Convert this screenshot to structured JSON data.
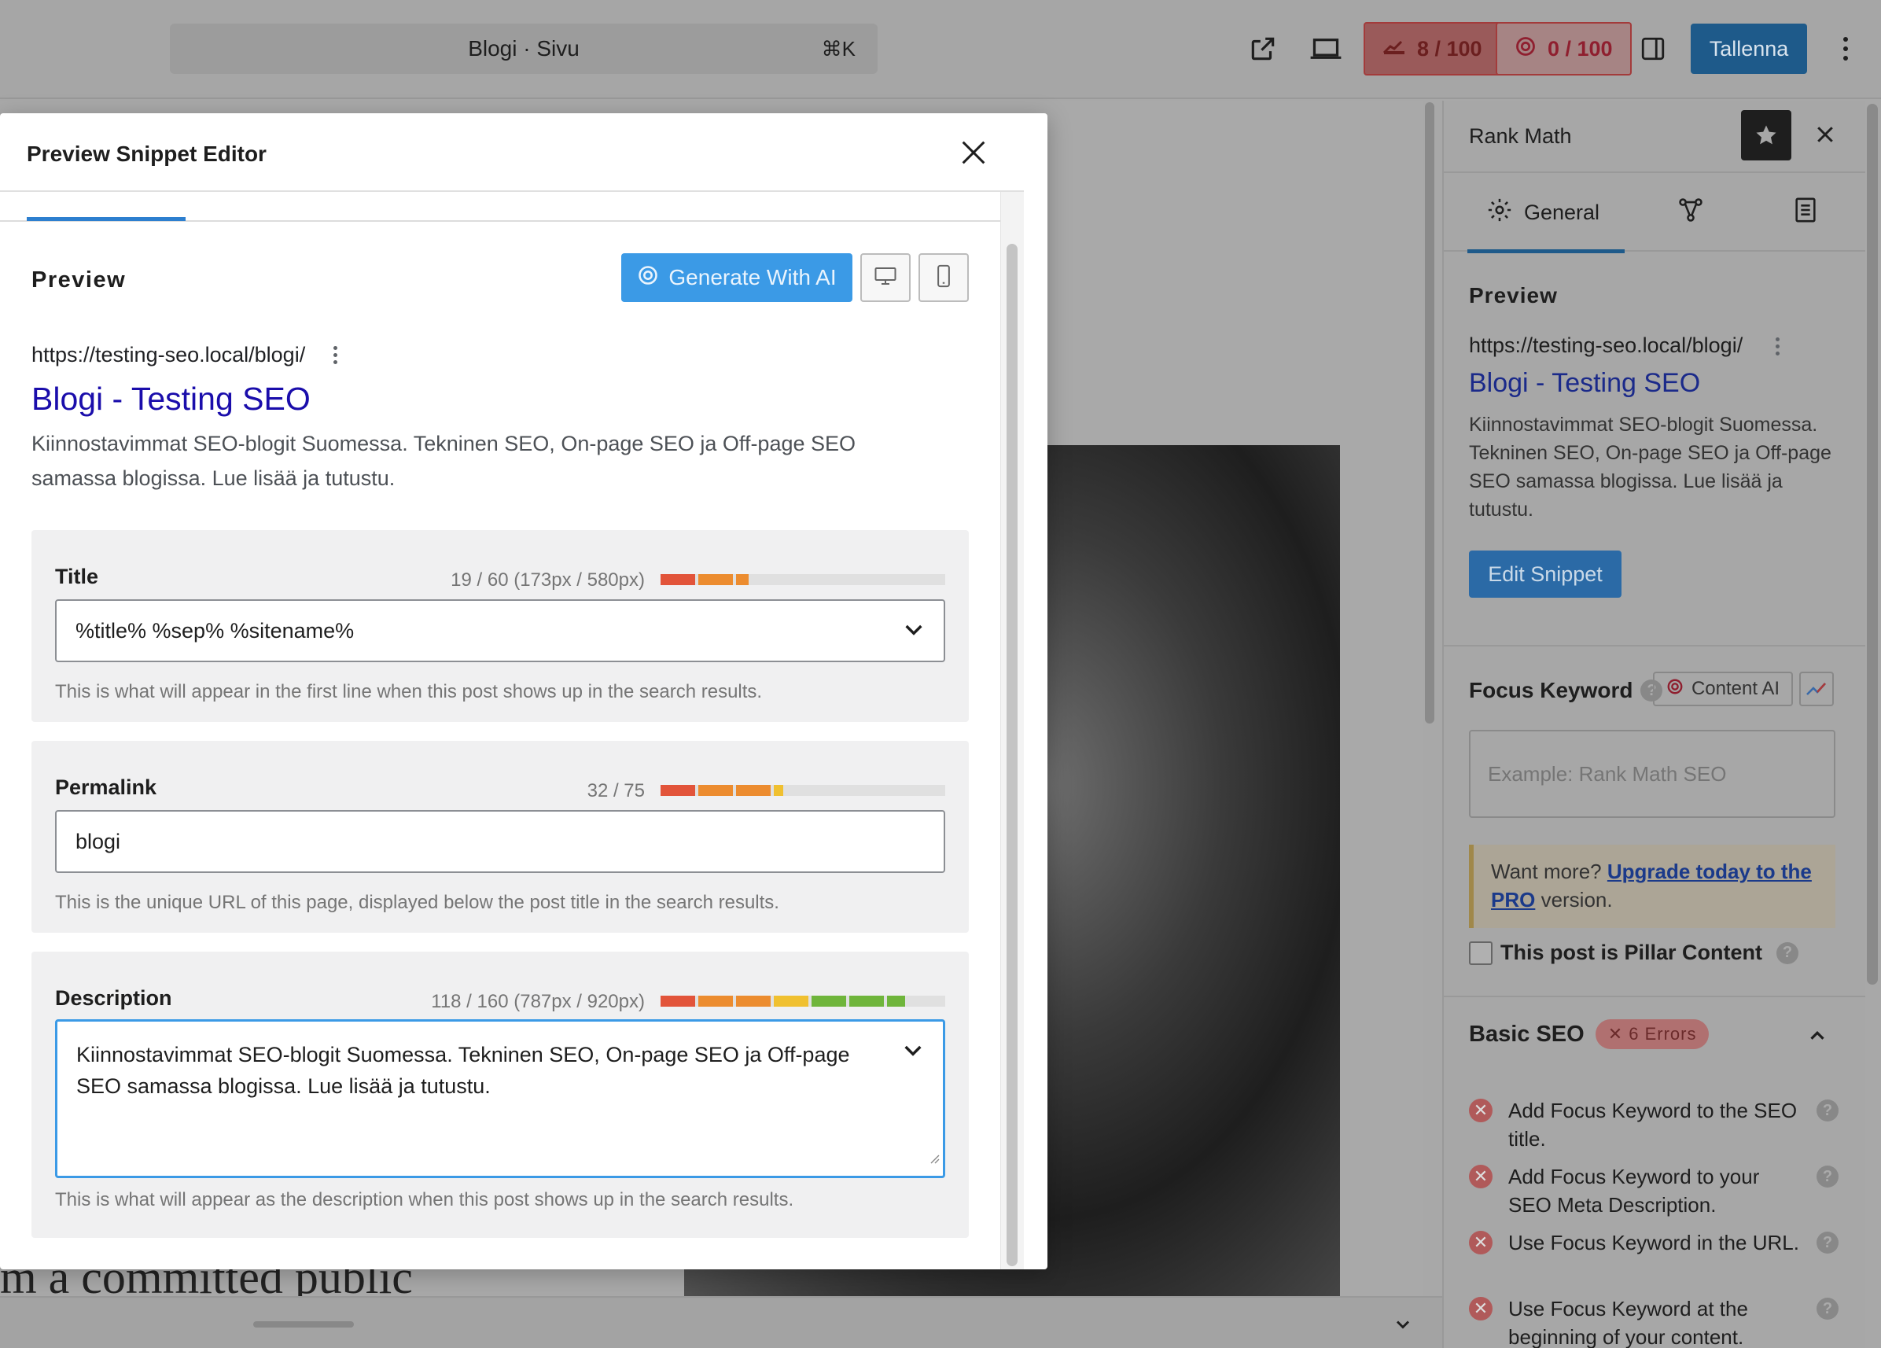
{
  "topbar": {
    "command": "Blogi · Sivu",
    "shortcut": "⌘K",
    "seo_score": "8 / 100",
    "ai_score": "0 / 100",
    "save_label": "Tallenna"
  },
  "canvas": {
    "text_fragment": "m a committed public"
  },
  "sidebar": {
    "title": "Rank Math",
    "tabs": [
      {
        "label": "General",
        "icon": "gear-icon"
      },
      {
        "label": "",
        "icon": "schema-icon"
      },
      {
        "label": "",
        "icon": "document-icon"
      }
    ],
    "preview_heading": "Preview",
    "url": "https://testing-seo.local/blogi/",
    "link_title": "Blogi - Testing SEO",
    "description": "Kiinnostavimmat SEO-blogit Suomessa. Tekninen SEO, On-page SEO ja Off-page SEO samassa blogissa. Lue lisää ja tutustu.",
    "edit_snippet_label": "Edit Snippet",
    "focus_keyword_label": "Focus Keyword",
    "content_ai_label": "Content AI",
    "focus_keyword_placeholder": "Example: Rank Math SEO",
    "upgrade": {
      "prefix": "Want more? ",
      "link": "Upgrade today to the PRO",
      "suffix": " version."
    },
    "pillar_label": "This post is Pillar Content",
    "basic_seo_label": "Basic SEO",
    "errors_badge": "6 Errors",
    "checks": [
      "Add Focus Keyword to the SEO title.",
      "Add Focus Keyword to your SEO Meta Description.",
      "Use Focus Keyword in the URL.",
      "Use Focus Keyword at the beginning of your content."
    ]
  },
  "modal": {
    "title": "Preview Snippet Editor",
    "preview_label": "Preview",
    "generate_ai_label": "Generate With AI",
    "preview_url": "https://testing-seo.local/blogi/",
    "preview_link": "Blogi - Testing SEO",
    "preview_desc": "Kiinnostavimmat SEO-blogit Suomessa. Tekninen SEO, On-page SEO ja Off-page SEO samassa blogissa. Lue lisää ja tutustu.",
    "title_field": {
      "label": "Title",
      "count": "19 / 60 (173px / 580px)",
      "fill": 0.31,
      "value": "%title% %sep% %sitename%",
      "help": "This is what will appear in the first line when this post shows up in the search results."
    },
    "permalink_field": {
      "label": "Permalink",
      "count": "32 / 75",
      "fill": 0.43,
      "value": "blogi",
      "help": "This is the unique URL of this page, displayed below the post title in the search results."
    },
    "description_field": {
      "label": "Description",
      "count": "118 / 160 (787px / 920px)",
      "fill": 0.86,
      "value": "Kiinnostavimmat SEO-blogit Suomessa. Tekninen SEO, On-page SEO ja Off-page SEO samassa blogissa. Lue lisää ja tutustu.",
      "help": "This is what will appear as the description when this post shows up in the search results."
    }
  },
  "colors": {
    "accent": "#3b9ae6",
    "link": "#1a0dab",
    "meter_red": "#e2543a",
    "meter_orange": "#ec8c2f",
    "meter_yellow": "#f0c030",
    "meter_green": "#6fb53b"
  }
}
